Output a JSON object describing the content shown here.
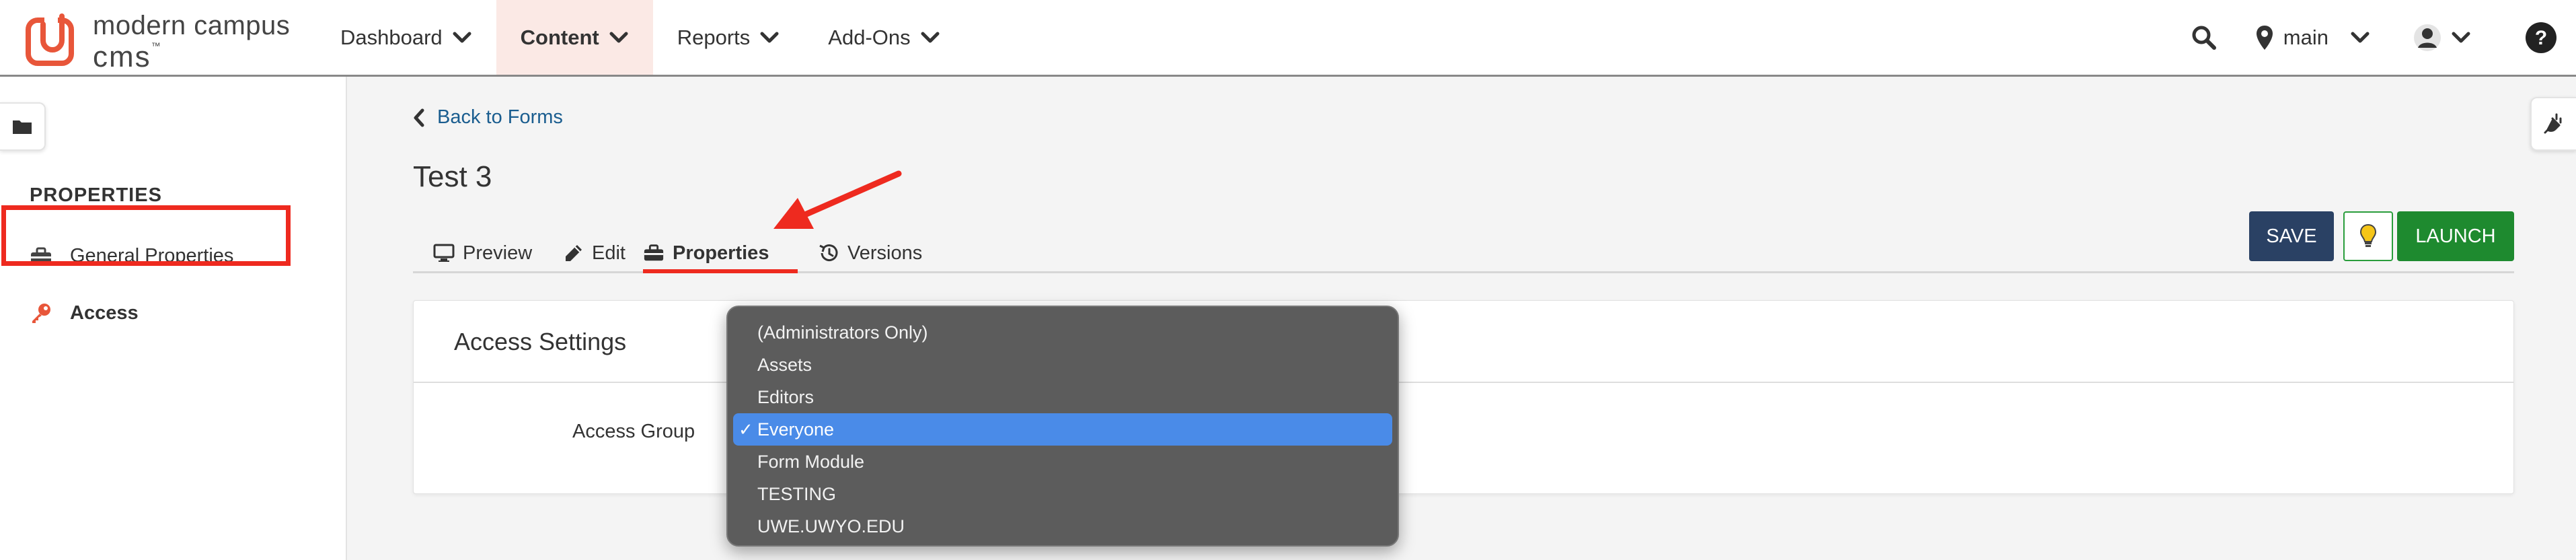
{
  "brand": {
    "line1": "modern campus",
    "line2": "cms",
    "tm": "™",
    "accent_color": "#e8563a"
  },
  "nav": {
    "items": [
      {
        "label": "Dashboard",
        "icon": "chevron-down-icon"
      },
      {
        "label": "Content",
        "icon": "chevron-down-icon",
        "active": true
      },
      {
        "label": "Reports",
        "icon": "chevron-down-icon"
      },
      {
        "label": "Add-Ons",
        "icon": "chevron-down-icon"
      }
    ]
  },
  "tools": {
    "search_icon": "search-icon",
    "site_label": "main",
    "site_icon": "map-pin-icon",
    "user_icon": "user-icon",
    "help_icon": "help-icon"
  },
  "sidebar": {
    "heading": "PROPERTIES",
    "items": [
      {
        "label": "General Properties",
        "icon": "toolbox-icon"
      },
      {
        "label": "Access",
        "icon": "key-icon",
        "active": true
      }
    ]
  },
  "page": {
    "back_label": "Back to Forms",
    "title": "Test 3"
  },
  "tabs": [
    {
      "label": "Preview",
      "icon": "monitor-icon"
    },
    {
      "label": "Edit",
      "icon": "pencil-icon"
    },
    {
      "label": "Properties",
      "icon": "toolbox-icon",
      "active": true
    },
    {
      "label": "Versions",
      "icon": "history-icon"
    }
  ],
  "actions": {
    "save_label": "SAVE",
    "launch_label": "LAUNCH",
    "bulb_icon": "lightbulb-icon"
  },
  "access_card": {
    "title": "Access Settings",
    "field_label": "Access Group"
  },
  "dropdown": {
    "options": [
      "(Administrators Only)",
      "Assets",
      "Editors",
      "Everyone",
      "Form Module",
      "TESTING",
      "UWE.UWYO.EDU"
    ],
    "selected": "Everyone",
    "check_glyph": "✓"
  },
  "colors": {
    "save_bg": "#2a4164",
    "launch_bg": "#1e8a2f",
    "highlight_red": "#ee2a1f",
    "link_blue": "#1a5d8f",
    "selected_option": "#4a8be8"
  }
}
